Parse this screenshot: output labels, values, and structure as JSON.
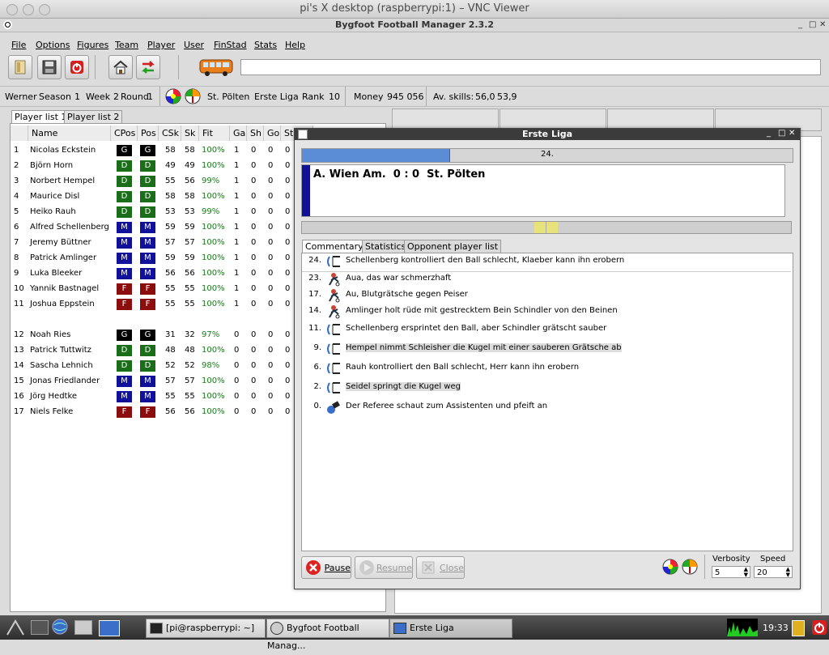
{
  "mac_window": {
    "title": "pi's X desktop (raspberrypi:1) – VNC Viewer"
  },
  "app": {
    "title": "Bygfoot Football Manager 2.3.2"
  },
  "menu": [
    "File",
    "Options",
    "Figures",
    "Team",
    "Player",
    "User",
    "FinStad",
    "Stats",
    "Help"
  ],
  "info": {
    "user": "Werner",
    "season_label": "Season",
    "season": "1",
    "week_label": "Week",
    "week": "2",
    "round_label": "Round",
    "round": "1",
    "team": "St. Pölten",
    "league": "Erste Liga",
    "rank_label": "Rank",
    "rank": "10",
    "money_label": "Money",
    "money": "945 056",
    "skills_label": "Av. skills:",
    "skills1": "56,0",
    "skills2": "53,9"
  },
  "player_tabs": [
    "Player list 1",
    "Player list 2"
  ],
  "columns": [
    "Name",
    "CPos",
    "Pos",
    "CSk",
    "Sk",
    "Fit",
    "Ga",
    "Sh",
    "Go",
    "Sta"
  ],
  "players": [
    {
      "n": "1",
      "name": "Nicolas Eckstein",
      "cpos": "G",
      "pos": "G",
      "csk": "58",
      "sk": "58",
      "fit": "100%",
      "ga": "1",
      "sh": "0",
      "go": "0",
      "st": "0"
    },
    {
      "n": "2",
      "name": "Björn Horn",
      "cpos": "D",
      "pos": "D",
      "csk": "49",
      "sk": "49",
      "fit": "100%",
      "ga": "1",
      "sh": "0",
      "go": "0",
      "st": "0"
    },
    {
      "n": "3",
      "name": "Norbert Hempel",
      "cpos": "D",
      "pos": "D",
      "csk": "55",
      "sk": "56",
      "fit": "99%",
      "ga": "1",
      "sh": "0",
      "go": "0",
      "st": "0"
    },
    {
      "n": "4",
      "name": "Maurice Disl",
      "cpos": "D",
      "pos": "D",
      "csk": "58",
      "sk": "58",
      "fit": "100%",
      "ga": "1",
      "sh": "0",
      "go": "0",
      "st": "0"
    },
    {
      "n": "5",
      "name": "Heiko Rauh",
      "cpos": "D",
      "pos": "D",
      "csk": "53",
      "sk": "53",
      "fit": "99%",
      "ga": "1",
      "sh": "0",
      "go": "0",
      "st": "0"
    },
    {
      "n": "6",
      "name": "Alfred Schellenberg",
      "cpos": "M",
      "pos": "M",
      "csk": "59",
      "sk": "59",
      "fit": "100%",
      "ga": "1",
      "sh": "0",
      "go": "0",
      "st": "0"
    },
    {
      "n": "7",
      "name": "Jeremy Büttner",
      "cpos": "M",
      "pos": "M",
      "csk": "57",
      "sk": "57",
      "fit": "100%",
      "ga": "1",
      "sh": "0",
      "go": "0",
      "st": "0"
    },
    {
      "n": "8",
      "name": "Patrick Amlinger",
      "cpos": "M",
      "pos": "M",
      "csk": "59",
      "sk": "59",
      "fit": "100%",
      "ga": "1",
      "sh": "0",
      "go": "0",
      "st": "0"
    },
    {
      "n": "9",
      "name": "Luka Bleeker",
      "cpos": "M",
      "pos": "M",
      "csk": "56",
      "sk": "56",
      "fit": "100%",
      "ga": "1",
      "sh": "0",
      "go": "0",
      "st": "0"
    },
    {
      "n": "10",
      "name": "Yannik Bastnagel",
      "cpos": "F",
      "pos": "F",
      "csk": "55",
      "sk": "55",
      "fit": "100%",
      "ga": "1",
      "sh": "0",
      "go": "0",
      "st": "0"
    },
    {
      "n": "11",
      "name": "Joshua Eppstein",
      "cpos": "F",
      "pos": "F",
      "csk": "55",
      "sk": "55",
      "fit": "100%",
      "ga": "1",
      "sh": "0",
      "go": "0",
      "st": "0"
    },
    {
      "n": "12",
      "name": "Noah Ries",
      "cpos": "G",
      "pos": "G",
      "csk": "31",
      "sk": "32",
      "fit": "97%",
      "ga": "0",
      "sh": "0",
      "go": "0",
      "st": "0"
    },
    {
      "n": "13",
      "name": "Patrick Tuttwitz",
      "cpos": "D",
      "pos": "D",
      "csk": "48",
      "sk": "48",
      "fit": "100%",
      "ga": "0",
      "sh": "0",
      "go": "0",
      "st": "0"
    },
    {
      "n": "14",
      "name": "Sascha Lehnich",
      "cpos": "D",
      "pos": "D",
      "csk": "52",
      "sk": "52",
      "fit": "98%",
      "ga": "0",
      "sh": "0",
      "go": "0",
      "st": "0"
    },
    {
      "n": "15",
      "name": "Jonas Friedlander",
      "cpos": "M",
      "pos": "M",
      "csk": "57",
      "sk": "57",
      "fit": "100%",
      "ga": "0",
      "sh": "0",
      "go": "0",
      "st": "0"
    },
    {
      "n": "16",
      "name": "Jörg Hedtke",
      "cpos": "M",
      "pos": "M",
      "csk": "55",
      "sk": "55",
      "fit": "100%",
      "ga": "0",
      "sh": "0",
      "go": "0",
      "st": "0"
    },
    {
      "n": "17",
      "name": "Niels Felke",
      "cpos": "F",
      "pos": "F",
      "csk": "56",
      "sk": "56",
      "fit": "100%",
      "ga": "0",
      "sh": "0",
      "go": "0",
      "st": "0"
    }
  ],
  "pos_colors": {
    "G": "#000000",
    "D": "#1a6e1a",
    "M": "#10109a",
    "F": "#8c0d0d"
  },
  "dialog": {
    "title": "Erste Liga",
    "minute": "24.",
    "progress": 0.3,
    "score": "A. Wien Am.  0 : 0  St. Pölten",
    "tabs": [
      "Commentary",
      "Statistics",
      "Opponent player list"
    ],
    "commentary": [
      {
        "min": "24.",
        "icon": "tackle-icon",
        "text": "Schellenberg kontrolliert den Ball schlecht, Klaeber kann ihn erobern"
      },
      {
        "min": "23.",
        "icon": "foul-icon",
        "text": "Aua, das war schmerzhaft"
      },
      {
        "min": "17.",
        "icon": "foul-icon",
        "text": "Au, Blutgrätsche gegen Peiser"
      },
      {
        "min": "14.",
        "icon": "foul-icon",
        "text": "Amlinger holt rüde mit gestrecktem Bein Schindler von den Beinen"
      },
      {
        "min": "11.",
        "icon": "tackle-icon",
        "text": "Schellenberg ersprintet den Ball, aber Schindler grätscht sauber"
      },
      {
        "min": "9.",
        "icon": "tackle-icon",
        "text": "Hempel nimmt Schleisher die Kugel mit einer sauberen Grätsche ab"
      },
      {
        "min": "6.",
        "icon": "tackle-icon",
        "text": "Rauh kontrolliert den Ball schlecht, Herr kann ihn erobern"
      },
      {
        "min": "2.",
        "icon": "tackle-icon",
        "text": "Seidel springt die Kugel weg"
      },
      {
        "min": "0.",
        "icon": "whistle-icon",
        "text": "Der Referee schaut zum Assistenten und pfeift an"
      }
    ],
    "pause": "Pause",
    "resume": "Resume",
    "close": "Close",
    "verbosity_label": "Verbosity",
    "verbosity": "5",
    "speed_label": "Speed",
    "speed": "20"
  },
  "taskbar": {
    "tasks": [
      "[pi@raspberrypi: ~]",
      "Bygfoot Football Manag...",
      "Erste Liga"
    ],
    "clock": "19:33"
  }
}
